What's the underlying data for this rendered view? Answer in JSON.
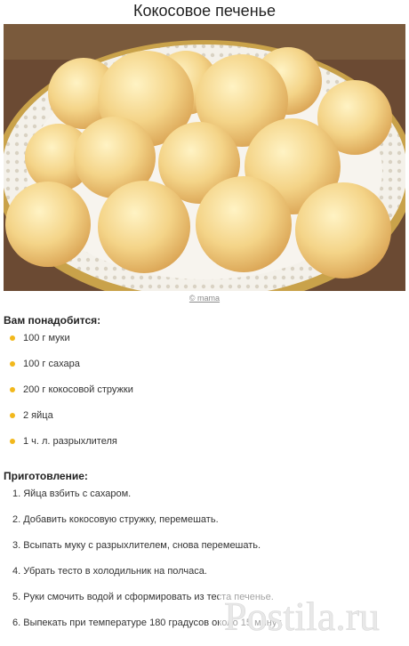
{
  "page": {
    "title": "Кокосовое печенье",
    "photo_credit": "© mama"
  },
  "ingredients": {
    "heading": "Вам понадобится:",
    "items": [
      "100 г муки",
      "100 г сахара",
      "200 г кокосовой стружки",
      "2 яйца",
      "1 ч. л. разрыхлителя"
    ]
  },
  "preparation": {
    "heading": "Приготовление:",
    "steps": [
      "1. Яйца взбить с сахаром.",
      "2. Добавить кокосовую стружку, перемешать.",
      "3. Всыпать муку с разрыхлителем, снова перемешать.",
      "4. Убрать тесто в холодильник на полчаса.",
      "5. Руки смочить водой и сформировать из теста печенье.",
      "6. Выпекать при температуре 180 градусов около 15 минут."
    ]
  },
  "watermark": {
    "brand": "Postila.ru"
  },
  "colors": {
    "bullet": "#f2b81c",
    "cookie": "#f3d58a",
    "doily": "#f4f1ea",
    "background": "#6b4a33"
  }
}
